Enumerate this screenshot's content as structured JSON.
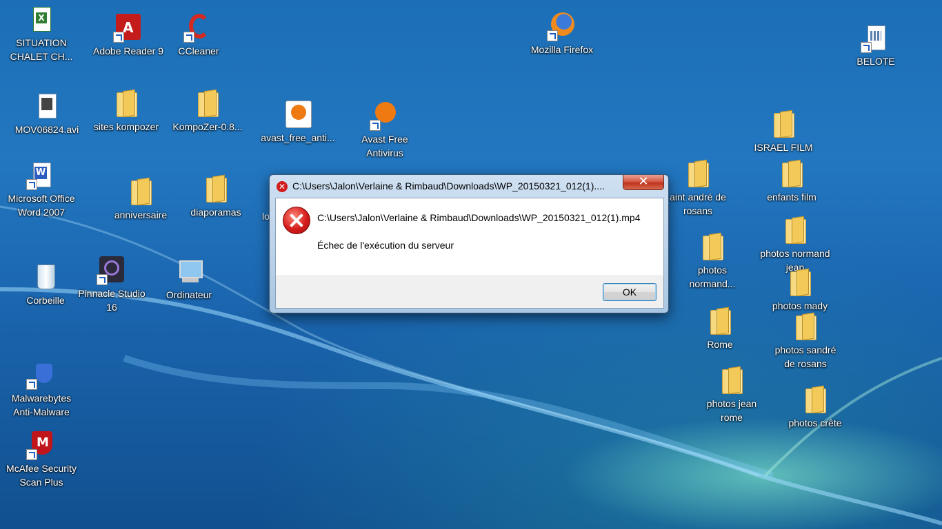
{
  "desktop": {
    "icons": [
      {
        "label": "SITUATION\nCHALET CH...",
        "type": "excel-icon"
      },
      {
        "label": "Adobe Reader 9",
        "type": "adobe-reader-icon"
      },
      {
        "label": "CCleaner",
        "type": "ccleaner-icon"
      },
      {
        "label": "Mozilla Firefox",
        "type": "firefox-icon"
      },
      {
        "label": "BELOTE",
        "type": "document-icon"
      },
      {
        "label": "MOV06824.avi",
        "type": "avi-file-icon"
      },
      {
        "label": "sites kompozer",
        "type": "folder-icon"
      },
      {
        "label": "KompoZer-0.8...",
        "type": "folder-icon"
      },
      {
        "label": "avast_free_anti...",
        "type": "avast-installer-icon"
      },
      {
        "label": "Avast Free\nAntivirus",
        "type": "avast-icon"
      },
      {
        "label": "ISRAEL FILM",
        "type": "folder-icon"
      },
      {
        "label": "Microsoft Office\nWord 2007",
        "type": "word-icon"
      },
      {
        "label": "anniversaire",
        "type": "folder-icon"
      },
      {
        "label": "diaporamas",
        "type": "folder-icon"
      },
      {
        "label": "aint andré de\nrosans",
        "type": "folder-icon"
      },
      {
        "label": "enfants film",
        "type": "folder-icon"
      },
      {
        "label": "photos normand\njean",
        "type": "folder-icon"
      },
      {
        "label": "photos\nnormand...",
        "type": "folder-icon"
      },
      {
        "label": "Corbeille",
        "type": "recycle-bin-icon"
      },
      {
        "label": "Pinnacle Studio\n16",
        "type": "pinnacle-icon"
      },
      {
        "label": "Ordinateur",
        "type": "computer-icon"
      },
      {
        "label": "photos mady",
        "type": "folder-icon"
      },
      {
        "label": "Rome",
        "type": "folder-icon"
      },
      {
        "label": "photos sandré\nde rosans",
        "type": "folder-icon"
      },
      {
        "label": "Malwarebytes\nAnti-Malware",
        "type": "malwarebytes-icon"
      },
      {
        "label": "photos jean\nrome",
        "type": "folder-icon"
      },
      {
        "label": "photos crête",
        "type": "folder-icon"
      },
      {
        "label": "McAfee Security\nScan Plus",
        "type": "mcafee-icon"
      }
    ],
    "partial_label": "lo"
  },
  "dialog": {
    "title": "C:\\Users\\Jalon\\Verlaine & Rimbaud\\Downloads\\WP_20150321_012(1)....",
    "close_label": "✕",
    "path": "C:\\Users\\Jalon\\Verlaine & Rimbaud\\Downloads\\WP_20150321_012(1).mp4",
    "message": "Échec de l'exécution du serveur",
    "ok_label": "OK"
  },
  "colors": {
    "desktop_blue": "#1c6fb6",
    "error_red": "#d21c1c",
    "button_border": "#3c7fb1"
  }
}
